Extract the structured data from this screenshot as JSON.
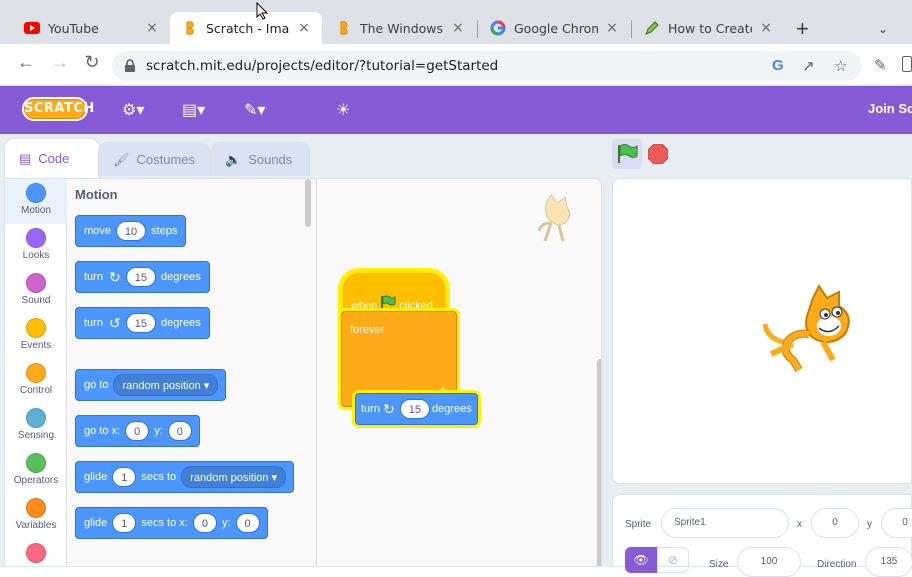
{
  "browser": {
    "tabs": [
      {
        "title": "YouTube",
        "icon": "youtube-icon"
      },
      {
        "title": "Scratch - Imagin",
        "icon": "scratch-icon"
      },
      {
        "title": "The Windows Vid",
        "icon": "scratch-icon"
      },
      {
        "title": "Google Chrome |",
        "icon": "google-icon"
      },
      {
        "title": "How to Create a",
        "icon": "pencil-icon"
      }
    ],
    "close_glyph": "×",
    "new_tab_glyph": "+",
    "url": "scratch.mit.edu/projects/editor/?tutorial=getStarted"
  },
  "scratch": {
    "logo": "SCRATCH",
    "join_label": "Join Scratch",
    "editor_tabs": [
      {
        "label": "Code"
      },
      {
        "label": "Costumes"
      },
      {
        "label": "Sounds"
      }
    ],
    "categories": [
      {
        "label": "Motion",
        "color": "#4c97ff"
      },
      {
        "label": "Looks",
        "color": "#9966ff"
      },
      {
        "label": "Sound",
        "color": "#cf63cf"
      },
      {
        "label": "Events",
        "color": "#ffbf00"
      },
      {
        "label": "Control",
        "color": "#ffab19"
      },
      {
        "label": "Sensing",
        "color": "#5cb1d6"
      },
      {
        "label": "Operators",
        "color": "#59c059"
      },
      {
        "label": "Variables",
        "color": "#ff8c1a"
      },
      {
        "label": "",
        "color": "#ff6680"
      }
    ],
    "palette": {
      "title": "Motion",
      "move": {
        "t1": "move",
        "v": "10",
        "t2": "steps"
      },
      "turn_right": {
        "t1": "turn",
        "v": "15",
        "t2": "degrees"
      },
      "turn_left": {
        "t1": "turn",
        "v": "15",
        "t2": "degrees"
      },
      "goto": {
        "t1": "go to",
        "dd": "random position"
      },
      "goto_xy": {
        "t1": "go to x:",
        "x": "0",
        "t2": "y:",
        "y": "0"
      },
      "glide_to": {
        "t1": "glide",
        "v": "1",
        "t2": "secs to",
        "dd": "random position"
      },
      "glide_xy": {
        "t1": "glide",
        "v": "1",
        "t2": "secs to x:",
        "x": "0",
        "t3": "y:",
        "y": "0"
      }
    },
    "script": {
      "hat": {
        "t1": "when",
        "t2": "clicked"
      },
      "forever": "forever",
      "turn": {
        "t1": "turn",
        "v": "15",
        "t2": "degrees"
      }
    },
    "sprite_info": {
      "sprite_label": "Sprite",
      "sprite_name": "Sprite1",
      "x_label": "x",
      "x": "0",
      "y_label": "y",
      "y": "0",
      "size_label": "Size",
      "size": "100",
      "direction_label": "Direction",
      "direction": "135"
    }
  }
}
